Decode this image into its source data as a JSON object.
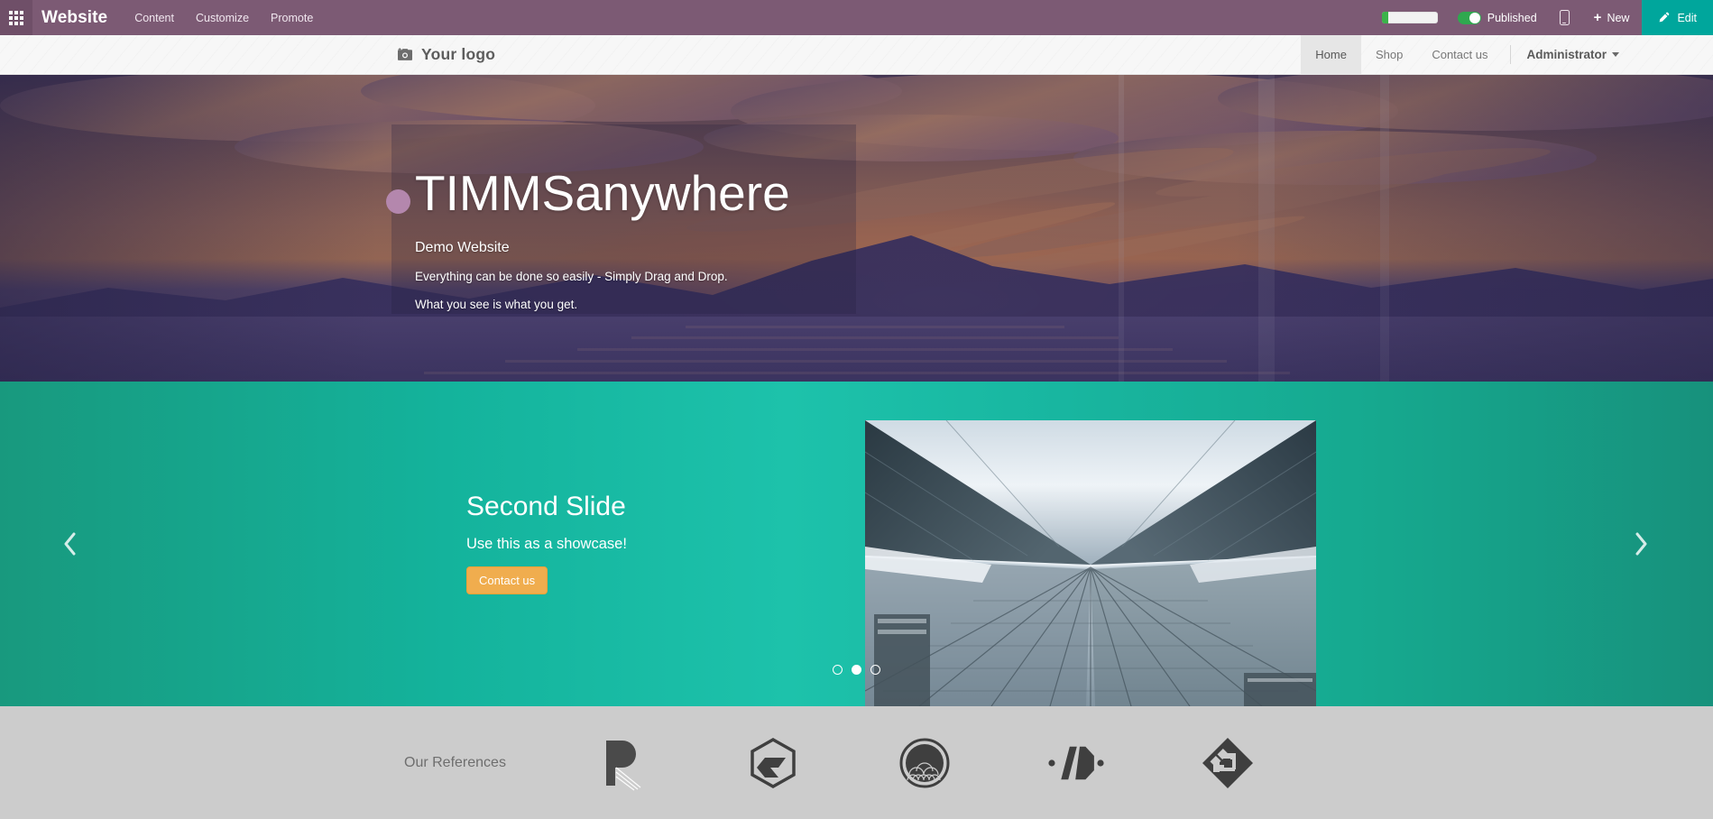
{
  "topbar": {
    "apps_icon": "apps-grid-icon",
    "app_name": "Website",
    "menus": [
      {
        "label": "Content"
      },
      {
        "label": "Customize"
      },
      {
        "label": "Promote"
      }
    ],
    "progress": {
      "icon": "progress-bar",
      "percent": 11
    },
    "publish": {
      "label": "Published",
      "state": "on",
      "toggle_color": "#2fa84f"
    },
    "mobile_preview_icon": "mobile-phone-icon",
    "new_button": {
      "label": "New",
      "icon": "plus-icon"
    },
    "edit_button": {
      "label": "Edit",
      "icon": "pencil-icon",
      "color": "#00a69c"
    },
    "background_color": "#7c5a74"
  },
  "site_header": {
    "logo": {
      "icon": "add-photo-icon",
      "label": "Your logo"
    },
    "nav": [
      {
        "label": "Home",
        "active": true
      },
      {
        "label": "Shop",
        "active": false
      },
      {
        "label": "Contact us",
        "active": false
      }
    ],
    "user_menu": {
      "label": "Administrator",
      "icon": "chevron-down-icon"
    }
  },
  "hero": {
    "title": "TIMMSanywhere",
    "subtitle": "Demo Website",
    "line1": "Everything can be done so easily - Simply Drag and Drop.",
    "line2": "What you see is what you get.",
    "bullet_color": "#b487ad",
    "background_alt": "sunset over mountains and sea"
  },
  "slide": {
    "title": "Second Slide",
    "subtitle": "Use this as a showcase!",
    "cta_label": "Contact us",
    "cta_color": "#f0ad4e",
    "background_color": "#1dc2ab",
    "prev_icon": "chevron-left-icon",
    "next_icon": "chevron-right-icon",
    "photo_alt": "glass skyscrapers looking upward",
    "indicators": [
      {
        "active": false
      },
      {
        "active": true
      },
      {
        "active": false
      }
    ]
  },
  "references": {
    "label": "Our References",
    "background_color": "#cccccc",
    "logos": [
      {
        "name": "logo-r-mark"
      },
      {
        "name": "logo-hexagon-outline"
      },
      {
        "name": "logo-circle-waves"
      },
      {
        "name": "logo-hexagon-dots"
      },
      {
        "name": "logo-diamond-maze"
      }
    ]
  }
}
